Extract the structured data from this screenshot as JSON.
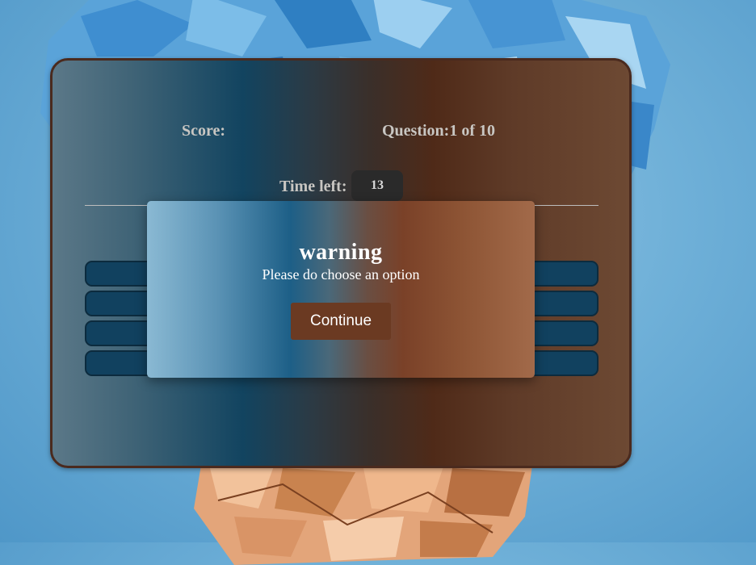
{
  "quiz": {
    "score_label": "Score:",
    "score_value": "",
    "question_label": "Question:",
    "question_progress": "1 of 10",
    "time_left_label": "Time left:",
    "time_left_value": "13",
    "options": [
      "",
      "",
      "",
      ""
    ]
  },
  "modal": {
    "title": "warning",
    "message": "Please do choose an option",
    "continue_label": "Continue"
  },
  "colors": {
    "option_fill": "#11415f",
    "button_fill": "#6b3a22",
    "timer_fill": "#2a2a2a"
  }
}
